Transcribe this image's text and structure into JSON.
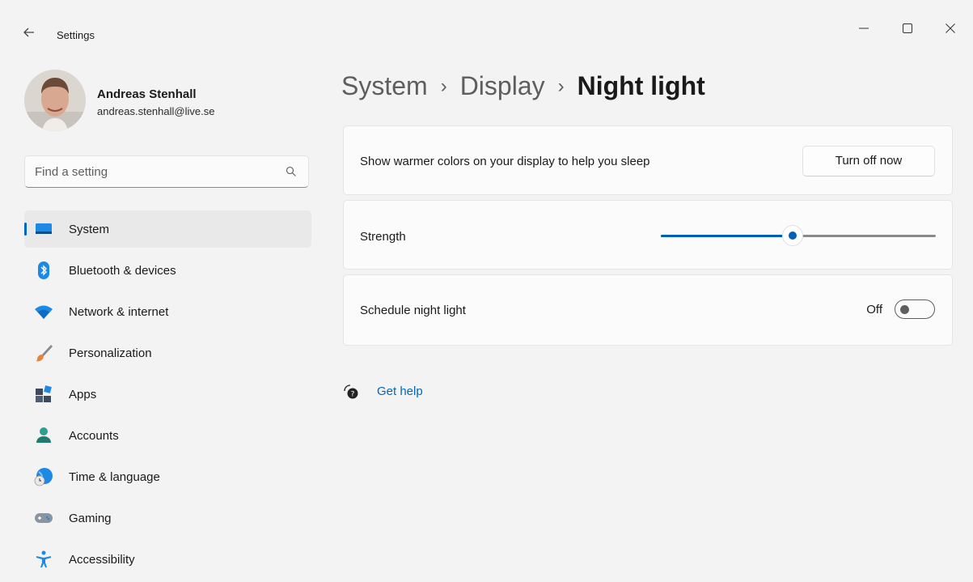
{
  "window": {
    "app_title": "Settings",
    "controls": [
      "minimize",
      "maximize",
      "close"
    ]
  },
  "profile": {
    "name": "Andreas Stenhall",
    "email": "andreas.stenhall@live.se"
  },
  "search": {
    "placeholder": "Find a setting"
  },
  "sidebar": {
    "items": [
      {
        "label": "System",
        "icon": "system-icon",
        "active": true
      },
      {
        "label": "Bluetooth & devices",
        "icon": "bluetooth-icon"
      },
      {
        "label": "Network & internet",
        "icon": "wifi-icon"
      },
      {
        "label": "Personalization",
        "icon": "brush-icon"
      },
      {
        "label": "Apps",
        "icon": "apps-icon"
      },
      {
        "label": "Accounts",
        "icon": "accounts-icon"
      },
      {
        "label": "Time & language",
        "icon": "globe-clock-icon"
      },
      {
        "label": "Gaming",
        "icon": "gamepad-icon"
      },
      {
        "label": "Accessibility",
        "icon": "accessibility-icon"
      }
    ]
  },
  "breadcrumb": {
    "items": [
      "System",
      "Display",
      "Night light"
    ],
    "separator": "›"
  },
  "night_light": {
    "description": "Show warmer colors on your display to help you sleep",
    "turn_off_button": "Turn off now",
    "strength_label": "Strength",
    "strength_value_fraction": 0.48,
    "schedule_label": "Schedule night light",
    "schedule_state": "Off"
  },
  "help": {
    "label": "Get help"
  },
  "colors": {
    "accent": "#005fb8",
    "link": "#0067c0",
    "background": "#f3f3f3",
    "card": "#fbfbfb"
  }
}
